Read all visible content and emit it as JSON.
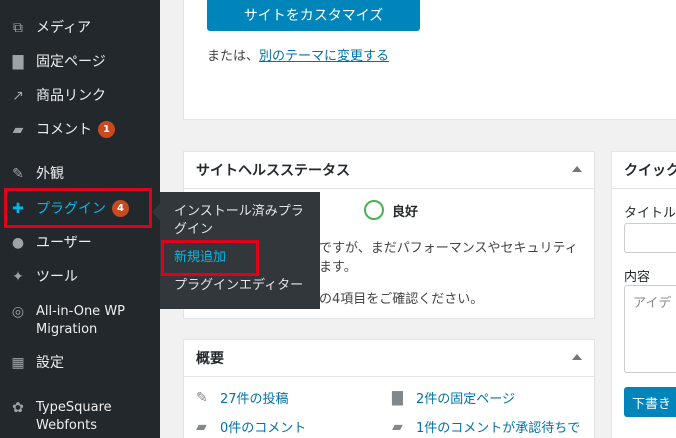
{
  "sidebar": {
    "items": [
      {
        "icon": "media-icon",
        "glyph": "⧉",
        "label": "メディア"
      },
      {
        "icon": "pages-icon",
        "glyph": "▇",
        "label": "固定ページ"
      },
      {
        "icon": "product-link-icon",
        "glyph": "↗",
        "label": "商品リンク"
      },
      {
        "icon": "comments-icon",
        "glyph": "▰",
        "label": "コメント",
        "badge": "1"
      },
      {
        "icon": "appearance-icon",
        "glyph": "✎",
        "label": "外観"
      },
      {
        "icon": "plugins-icon",
        "glyph": "✚",
        "label": "プラグイン",
        "badge": "4"
      },
      {
        "icon": "users-icon",
        "glyph": "●",
        "label": "ユーザー"
      },
      {
        "icon": "tools-icon",
        "glyph": "✦",
        "label": "ツール"
      },
      {
        "icon": "migration-icon",
        "glyph": "◎",
        "label": "All-in-One WP Migration"
      },
      {
        "icon": "settings-icon",
        "glyph": "▦",
        "label": "設定"
      },
      {
        "icon": "typesquare-icon",
        "glyph": "✿",
        "label": "TypeSquare Webfonts"
      }
    ]
  },
  "flyout": {
    "items": [
      {
        "label": "インストール済みプラグイン"
      },
      {
        "label": "新規追加"
      },
      {
        "label": "プラグインエディター"
      }
    ]
  },
  "welcome": {
    "customize_button": "サイトをカスタマイズ",
    "or_text": "または、",
    "change_theme_link": "別のテーマに変更する"
  },
  "site_health": {
    "title": "サイトヘルスステータス",
    "status": "良好",
    "body_line1": "ですが、まだパフォーマンスやセキュリティ",
    "body_line2": "ます。",
    "body_line3": "の4項目をご確認ください。"
  },
  "at_a_glance": {
    "title": "概要",
    "posts": "27件の投稿",
    "pages": "2件の固定ページ",
    "comments": "0件のコメント",
    "pending": "1件のコメントが承認待ちで"
  },
  "quick_draft": {
    "title": "クイック",
    "title_label": "タイトル",
    "content_label": "内容",
    "content_placeholder": "アイデ",
    "save_button": "下書き"
  },
  "colors": {
    "sidebar_bg": "#23282d",
    "accent": "#00b9eb",
    "badge": "#ca4a1f",
    "primary_button": "#0085ba",
    "highlight": "#e0001a"
  }
}
